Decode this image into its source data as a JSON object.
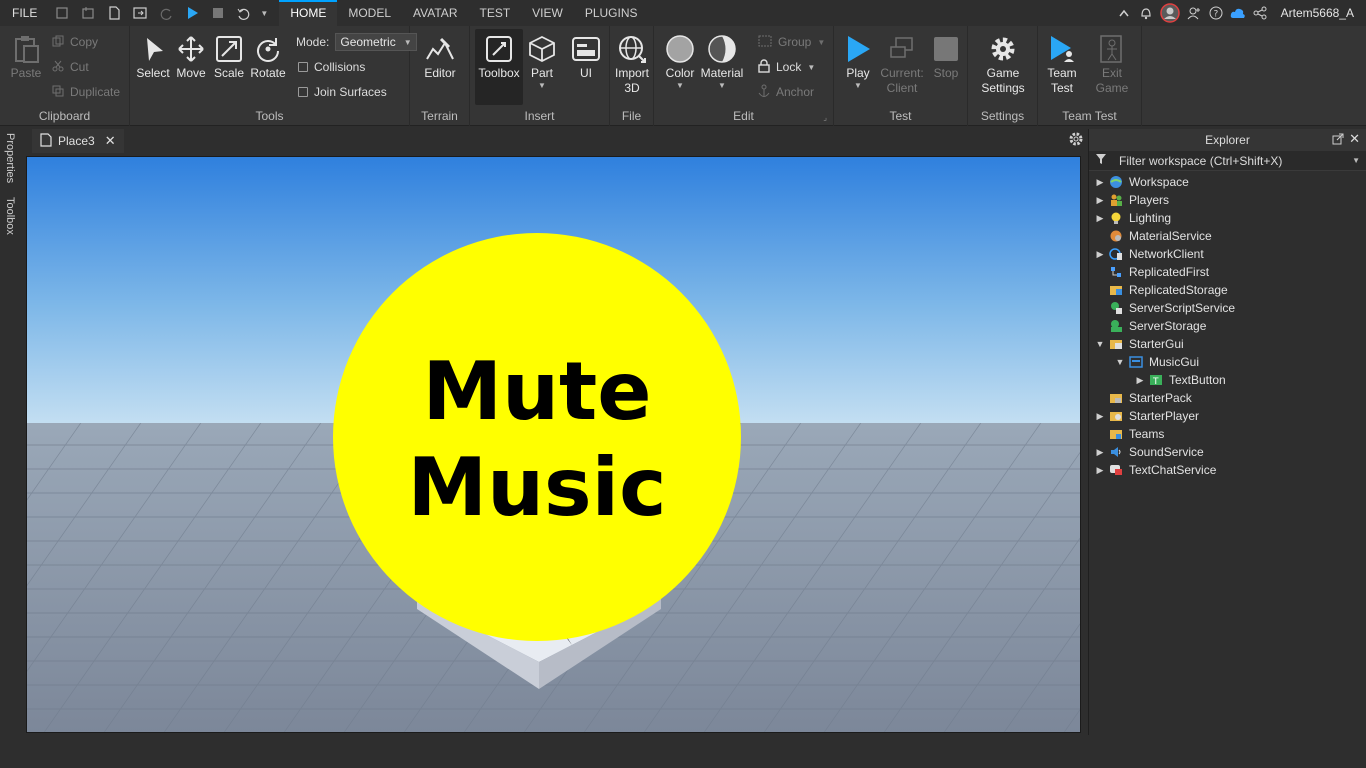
{
  "menu": {
    "file": "FILE",
    "tabs": [
      "HOME",
      "MODEL",
      "AVATAR",
      "TEST",
      "VIEW",
      "PLUGINS"
    ],
    "active_tab": "HOME",
    "username": "Artem5668_A"
  },
  "ribbon": {
    "clipboard": {
      "label": "Clipboard",
      "paste": "Paste",
      "copy": "Copy",
      "cut": "Cut",
      "duplicate": "Duplicate"
    },
    "tools": {
      "label": "Tools",
      "select": "Select",
      "move": "Move",
      "scale": "Scale",
      "rotate": "Rotate",
      "mode_label": "Mode:",
      "mode_value": "Geometric",
      "collisions": "Collisions",
      "join_surfaces": "Join Surfaces"
    },
    "terrain": {
      "label": "Terrain",
      "editor": "Editor"
    },
    "insert": {
      "label": "Insert",
      "toolbox": "Toolbox",
      "part": "Part",
      "ui": "UI"
    },
    "file": {
      "label": "File",
      "import_line1": "Import",
      "import_line2": "3D"
    },
    "edit": {
      "label": "Edit",
      "color": "Color",
      "material": "Material",
      "group": "Group",
      "lock": "Lock",
      "anchor": "Anchor"
    },
    "test": {
      "label": "Test",
      "play": "Play",
      "current_line1": "Current:",
      "current_line2": "Client",
      "stop": "Stop"
    },
    "settings": {
      "label": "Settings",
      "game_line1": "Game",
      "game_line2": "Settings"
    },
    "team_test": {
      "label": "Team Test",
      "team_line1": "Team",
      "team_line2": "Test",
      "exit_line1": "Exit",
      "exit_line2": "Game"
    }
  },
  "side_tabs": {
    "properties": "Properties",
    "toolbox": "Toolbox"
  },
  "document_tab": {
    "name": "Place3"
  },
  "viewport": {
    "button_line1": "Mute",
    "button_line2": "Music",
    "button_color": "#ffff00"
  },
  "explorer": {
    "title": "Explorer",
    "filter_placeholder": "Filter workspace (Ctrl+Shift+X)",
    "items": [
      {
        "name": "Workspace",
        "arrow": "right",
        "icon": "workspace-icon",
        "depth": 0
      },
      {
        "name": "Players",
        "arrow": "right",
        "icon": "players-icon",
        "depth": 0
      },
      {
        "name": "Lighting",
        "arrow": "right",
        "icon": "lighting-icon",
        "depth": 0
      },
      {
        "name": "MaterialService",
        "arrow": "",
        "icon": "material-service-icon",
        "depth": 0
      },
      {
        "name": "NetworkClient",
        "arrow": "right",
        "icon": "network-client-icon",
        "depth": 0
      },
      {
        "name": "ReplicatedFirst",
        "arrow": "",
        "icon": "replicated-first-icon",
        "depth": 0
      },
      {
        "name": "ReplicatedStorage",
        "arrow": "",
        "icon": "replicated-storage-icon",
        "depth": 0
      },
      {
        "name": "ServerScriptService",
        "arrow": "",
        "icon": "server-script-service-icon",
        "depth": 0
      },
      {
        "name": "ServerStorage",
        "arrow": "",
        "icon": "server-storage-icon",
        "depth": 0
      },
      {
        "name": "StarterGui",
        "arrow": "down",
        "icon": "starter-gui-icon",
        "depth": 0
      },
      {
        "name": "MusicGui",
        "arrow": "down",
        "icon": "screen-gui-icon",
        "depth": 1
      },
      {
        "name": "TextButton",
        "arrow": "right",
        "icon": "text-button-icon",
        "depth": 2
      },
      {
        "name": "StarterPack",
        "arrow": "",
        "icon": "starter-pack-icon",
        "depth": 0
      },
      {
        "name": "StarterPlayer",
        "arrow": "right",
        "icon": "starter-player-icon",
        "depth": 0
      },
      {
        "name": "Teams",
        "arrow": "",
        "icon": "teams-icon",
        "depth": 0
      },
      {
        "name": "SoundService",
        "arrow": "right",
        "icon": "sound-service-icon",
        "depth": 0
      },
      {
        "name": "TextChatService",
        "arrow": "right",
        "icon": "text-chat-service-icon",
        "depth": 0
      }
    ]
  },
  "colors": {
    "accent": "#00a2ff",
    "panel": "#2e2e2e",
    "ribbon": "#353535"
  }
}
